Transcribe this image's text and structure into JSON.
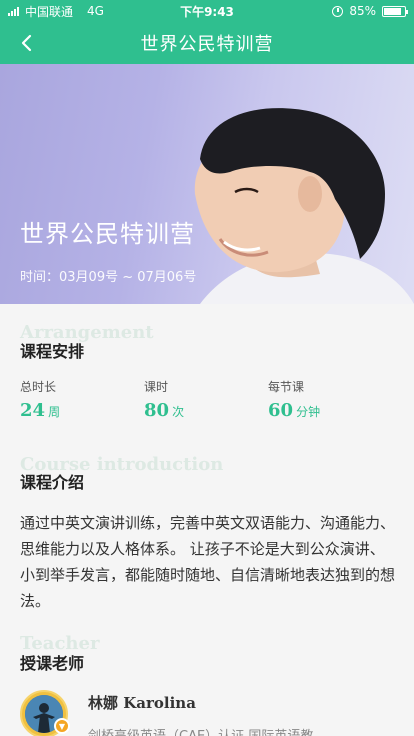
{
  "status_bar": {
    "carrier": "中国联通",
    "network": "4G",
    "time": "下午9:43",
    "battery": "85%",
    "battery_level": 0.85
  },
  "nav": {
    "title": "世界公民特训营",
    "back_icon": "chevron-left-icon"
  },
  "hero": {
    "title": "世界公民特训营",
    "time": "时间：03月09号 ~ 07月06号"
  },
  "arrangement": {
    "bg_title": "Arrangement",
    "title": "课程安排",
    "stats": [
      {
        "label": "总时长",
        "value": "24",
        "unit": "周"
      },
      {
        "label": "课时",
        "value": "80",
        "unit": "次"
      },
      {
        "label": "每节课",
        "value": "60",
        "unit": "分钟"
      }
    ]
  },
  "introduction": {
    "bg_title": "Course introduction",
    "title": "课程介绍",
    "text": "通过中英文演讲训练，完善中英文双语能力、沟通能力、思维能力以及人格体系。 让孩子不论是大到公众演讲、小到举手发言，都能随时随地、自信清晰地表达独到的想法。"
  },
  "teacher": {
    "bg_title": "Teacher",
    "title": "授课老师",
    "name_cn": "林娜",
    "name_en": "Karolina",
    "desc": "剑桥高级英语（CAE）认证 国际英语教"
  },
  "colors": {
    "accent": "#2fbf8f",
    "hero_bg": "#b5b2e6"
  }
}
